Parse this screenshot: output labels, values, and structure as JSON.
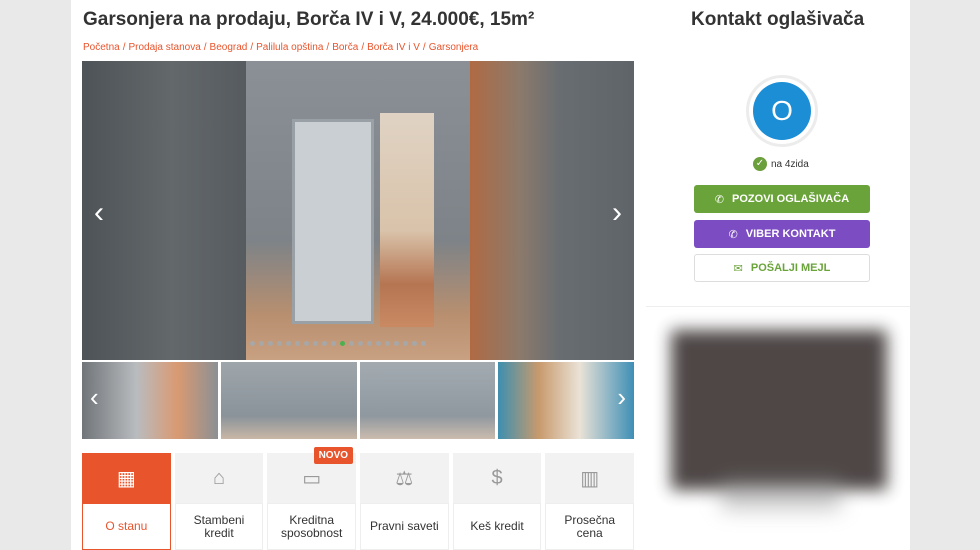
{
  "listing": {
    "title": "Garsonjera na prodaju, Borča IV i V, 24.000€, 15m²",
    "breadcrumb": [
      "Početna",
      "Prodaja stanova",
      "Beograd",
      "Palilula opština",
      "Borča",
      "Borča IV i V",
      "Garsonjera"
    ]
  },
  "gallery": {
    "prev_icon": "chevron-left-icon",
    "next_icon": "chevron-right-icon",
    "dot_count": 20,
    "active_dot": 10
  },
  "features": [
    {
      "label": "O stanu",
      "icon": "building-icon",
      "active": true
    },
    {
      "label": "Stambeni kredit",
      "icon": "bank-icon"
    },
    {
      "label": "Kreditna sposobnost",
      "icon": "card-icon",
      "badge": "NOVO"
    },
    {
      "label": "Pravni saveti",
      "icon": "scales-icon"
    },
    {
      "label": "Keš kredit",
      "icon": "dollar-icon"
    },
    {
      "label": "Prosečna cena",
      "icon": "chart-icon"
    }
  ],
  "contact": {
    "title": "Kontakt oglašivača",
    "avatar_letter": "O",
    "verified_text": "na 4zida",
    "call_label": "POZOVI OGLAŠIVAČA",
    "viber_label": "VIBER KONTAKT",
    "mail_label": "POŠALJI MEJL"
  },
  "colors": {
    "accent": "#e8542c",
    "call": "#6aa33a",
    "viber": "#7c4cc2",
    "avatar": "#1b8ed6"
  }
}
